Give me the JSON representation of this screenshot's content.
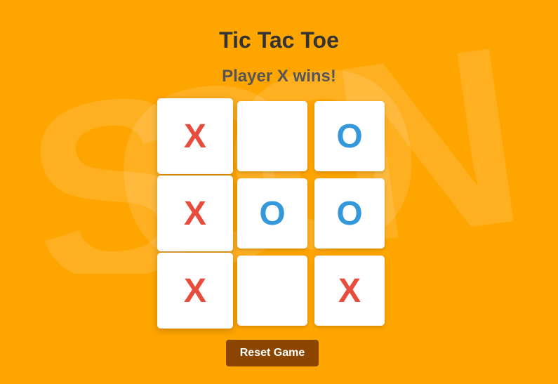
{
  "page": {
    "title": "Tic Tac Toe",
    "status": "Player X wins!",
    "background_color": "#FFA500",
    "watermark_text": "SOON"
  },
  "board": {
    "cells": [
      {
        "value": "X",
        "winning": true
      },
      {
        "value": "",
        "winning": false
      },
      {
        "value": "O",
        "winning": false
      },
      {
        "value": "X",
        "winning": true
      },
      {
        "value": "O",
        "winning": false
      },
      {
        "value": "O",
        "winning": false
      },
      {
        "value": "X",
        "winning": true
      },
      {
        "value": "",
        "winning": false
      },
      {
        "value": "X",
        "winning": false
      }
    ],
    "x_color": "#e74c3c",
    "o_color": "#3498db"
  },
  "controls": {
    "reset_label": "Reset Game",
    "reset_color": "#8B4500"
  }
}
